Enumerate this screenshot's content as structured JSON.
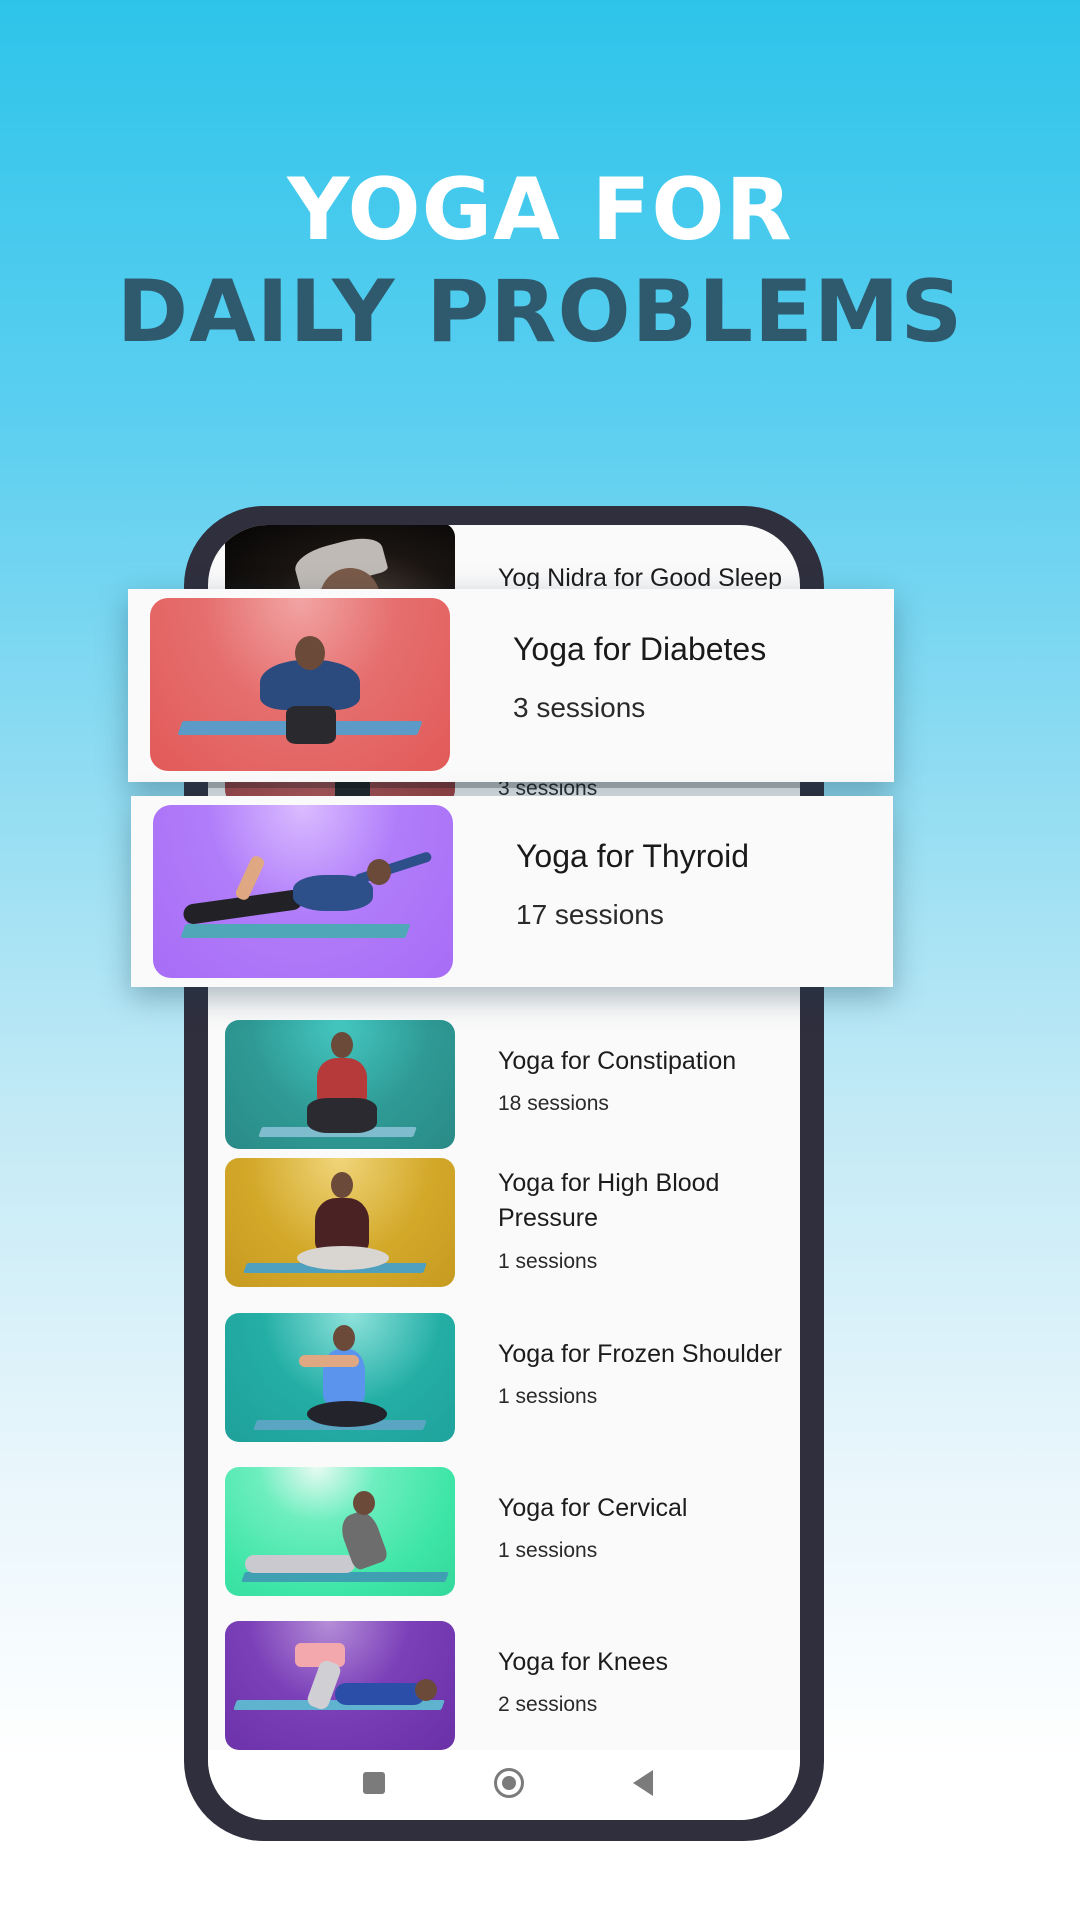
{
  "headline": {
    "line1": "YOGA FOR",
    "line2": "DAILY PROBLEMS"
  },
  "colors": {
    "bg_top": "#2ec4ea",
    "bg_bottom": "#ffffff",
    "headline_line1": "#ffffff",
    "headline_line2": "#2f5a6e",
    "phone_frame": "#302f3e",
    "screen_bg": "#fafafa"
  },
  "list": {
    "items": [
      {
        "title": "Yog Nidra for Good Sleep",
        "sessions": "",
        "thumb_color": "#1a1512",
        "thumb_icon": "sleeping-person-image"
      },
      {
        "title": "",
        "sessions": "3 sessions",
        "thumb_color": "#b14848",
        "thumb_icon": "yoga-pose-image"
      },
      {
        "title": "Yoga for Constipation",
        "sessions": "18 sessions",
        "thumb_color": "#2f9a95",
        "thumb_icon": "squat-pose-image"
      },
      {
        "title": "Yoga for High Blood Pressure",
        "sessions": "1 sessions",
        "thumb_color": "#d3a92a",
        "thumb_icon": "seated-pose-image"
      },
      {
        "title": "Yoga for Frozen Shoulder",
        "sessions": "1 sessions",
        "thumb_color": "#23aea5",
        "thumb_icon": "shoulder-stretch-image"
      },
      {
        "title": "Yoga for Cervical",
        "sessions": "1 sessions",
        "thumb_color": "#3de5a6",
        "thumb_icon": "cobra-pose-image"
      },
      {
        "title": "Yoga for Knees",
        "sessions": "2 sessions",
        "thumb_color": "#6a30a6",
        "thumb_icon": "bridge-pose-image"
      }
    ]
  },
  "featured": [
    {
      "title": "Yoga for Diabetes",
      "sessions": "3 sessions",
      "thumb_color": "#e25a59",
      "thumb_icon": "kneeling-pose-image"
    },
    {
      "title": "Yoga for Thyroid",
      "sessions": "17 sessions",
      "thumb_color": "#a86cf6",
      "thumb_icon": "bow-pose-image"
    }
  ],
  "navbar": {
    "recents": "recents-square-icon",
    "home": "home-circle-icon",
    "back": "back-triangle-icon"
  }
}
